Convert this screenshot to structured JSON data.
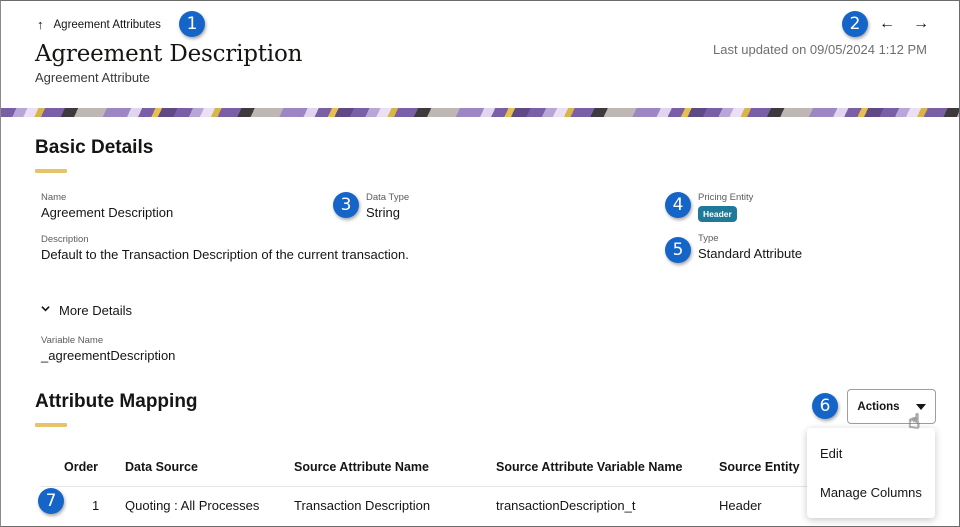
{
  "header": {
    "breadcrumb_arrow": "↑",
    "breadcrumb": "Agreement Attributes",
    "title": "Agreement Description",
    "subtitle": "Agreement Attribute",
    "prev_arrow": "←",
    "next_arrow": "→",
    "last_updated": "Last updated on 09/05/2024 1:12 PM"
  },
  "basic_details": {
    "title": "Basic Details",
    "name_label": "Name",
    "name_value": "Agreement Description",
    "data_type_label": "Data Type",
    "data_type_value": "String",
    "pricing_entity_label": "Pricing Entity",
    "pricing_entity_value": "Header",
    "description_label": "Description",
    "description_value": "Default to the Transaction Description of the current transaction.",
    "type_label": "Type",
    "type_value": "Standard Attribute",
    "more_details": "More Details",
    "variable_name_label": "Variable Name",
    "variable_name_value": "_agreementDescription"
  },
  "attribute_mapping": {
    "title": "Attribute Mapping",
    "actions_label": "Actions",
    "menu": [
      "Edit",
      "Manage Columns"
    ],
    "columns": [
      "Order",
      "Data Source",
      "Source Attribute Name",
      "Source Attribute Variable Name",
      "Source Entity"
    ],
    "rows": [
      [
        "1",
        "Quoting : All Processes",
        "Transaction Description",
        "transactionDescription_t",
        "Header"
      ]
    ]
  },
  "callouts": [
    "1",
    "2",
    "3",
    "4",
    "5",
    "6",
    "7"
  ],
  "colors": {
    "callout": "#1565c8",
    "badge": "#1f7a99",
    "accent_underline": "#e7c36a"
  }
}
